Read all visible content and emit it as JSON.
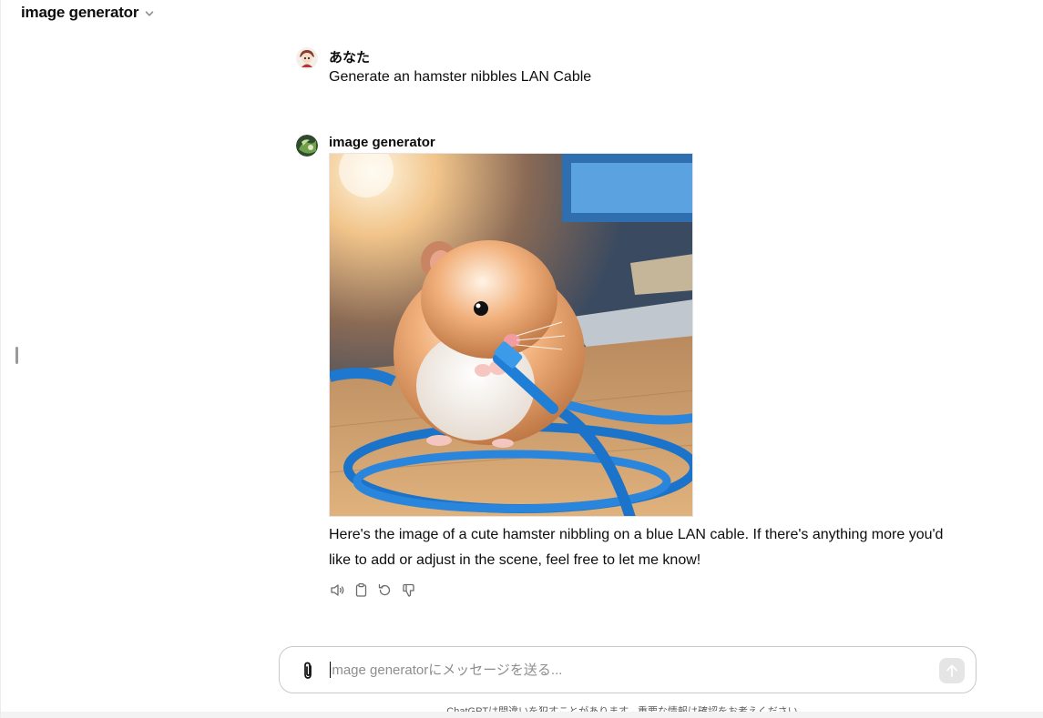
{
  "header": {
    "title": "image generator",
    "chevron_icon": "chevron-down-icon"
  },
  "conversation": {
    "user_message": {
      "author": "あなた",
      "text": "Generate an hamster nibbles LAN Cable"
    },
    "assistant_message": {
      "author": "image generator",
      "image_alt": "hamster nibbling blue LAN cable",
      "text": "Here's the image of a cute hamster nibbling on a blue LAN cable. If there's anything more you'd like to add or adjust in the scene, feel free to let me know!",
      "actions": [
        {
          "name": "read-aloud",
          "icon": "speaker-icon"
        },
        {
          "name": "copy",
          "icon": "clipboard-icon"
        },
        {
          "name": "regenerate",
          "icon": "refresh-icon"
        },
        {
          "name": "thumbs-down",
          "icon": "thumbs-down-icon"
        }
      ]
    }
  },
  "composer": {
    "placeholder": "image generatorにメッセージを送る...",
    "value": ""
  },
  "footer": {
    "disclaimer": "ChatGPTは間違いを犯すことがあります。重要な情報は確認をお考えください。"
  },
  "colors": {
    "text": "#0d0d0d",
    "muted": "#5d5d5d",
    "border": "#c9c9c9",
    "cable_blue": "#1f7fd6"
  }
}
